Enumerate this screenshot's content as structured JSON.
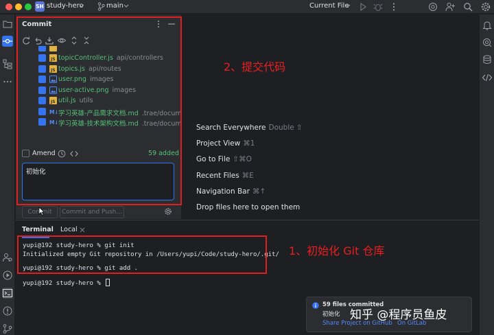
{
  "titlebar": {
    "project_badge": "SH",
    "project_name": "study-hero",
    "branch": "main",
    "run_config": "Current File"
  },
  "commit_panel": {
    "title": "Commit",
    "files": [
      {
        "name": "topicController.js",
        "path": "api/controllers",
        "icon": "js-file-icon"
      },
      {
        "name": "topics.js",
        "path": "api/routes",
        "icon": "js-file-icon"
      },
      {
        "name": "user.png",
        "path": "images",
        "icon": "image-file-icon"
      },
      {
        "name": "user-active.png",
        "path": "images",
        "icon": "image-file-icon"
      },
      {
        "name": "util.js",
        "path": "utils",
        "icon": "js-file-icon"
      },
      {
        "name": "学习英雄-产品需求文档.md",
        "path": ".trae/documents",
        "icon": "markdown-file-icon"
      },
      {
        "name": "学习英雄-技术架构文档.md",
        "path": ".trae/documents",
        "icon": "markdown-file-icon"
      }
    ],
    "amend_label": "Amend",
    "added_label": "59 added",
    "commit_message": "初始化",
    "commit_button": "Commit",
    "commit_push_button": "Commit and Push..."
  },
  "welcome": {
    "items": [
      {
        "label": "Search Everywhere",
        "shortcut": "Double ⇧"
      },
      {
        "label": "Project View",
        "shortcut": "⌘1"
      },
      {
        "label": "Go to File",
        "shortcut": "⇧⌘O"
      },
      {
        "label": "Recent Files",
        "shortcut": "⌘E"
      },
      {
        "label": "Navigation Bar",
        "shortcut": "⌘↑"
      },
      {
        "label": "Drop files here to open them",
        "shortcut": ""
      }
    ]
  },
  "terminal": {
    "tab_terminal": "Terminal",
    "tab_local": "Local",
    "lines": [
      "yupi@192 study-hero % git init",
      "Initialized empty Git repository in /Users/yupi/Code/study-hero/.git/",
      "yupi@192 study-hero % git add .",
      "yupi@192 study-hero % "
    ]
  },
  "notification": {
    "title": "59 files committed",
    "body": "初始化",
    "link1": "Share Project on GitHub",
    "link2": "On GitLab"
  },
  "annotations": {
    "commit_label": "2、提交代码",
    "init_label": "1、初始化 Git 仓库"
  },
  "watermark": "知乎 @程序员鱼皮",
  "colors": {
    "accent": "#3574f0",
    "added_green": "#57c078",
    "annotation_red": "#e02020"
  }
}
